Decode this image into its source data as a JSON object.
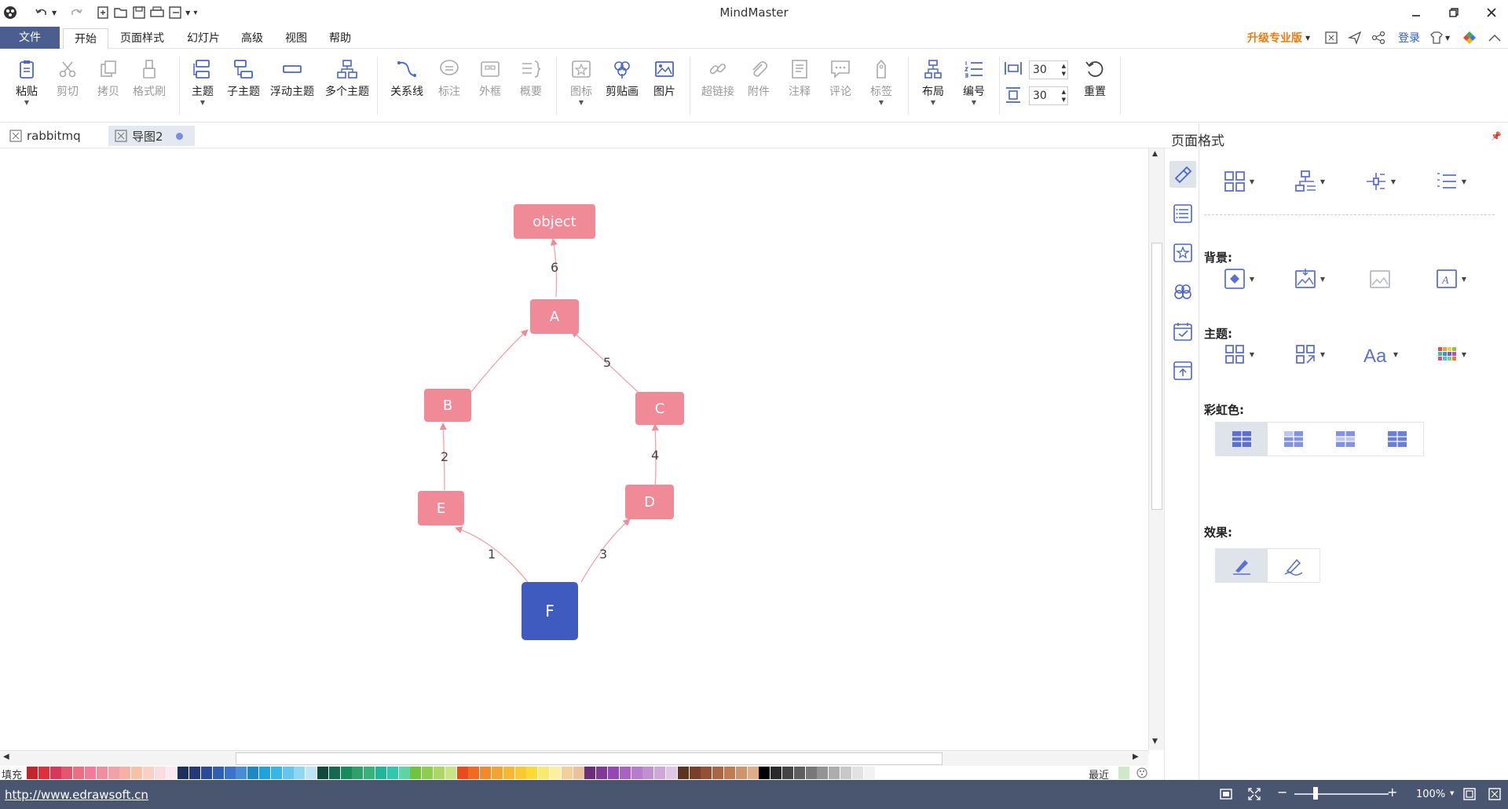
{
  "app": {
    "title": "MindMaster"
  },
  "menu": {
    "file": "文件",
    "items": [
      "开始",
      "页面样式",
      "幻灯片",
      "高级",
      "视图",
      "帮助"
    ],
    "upgrade": "升级专业版",
    "login": "登录"
  },
  "ribbon": {
    "paste": "粘贴",
    "cut": "剪切",
    "copy": "拷贝",
    "format_painter": "格式刷",
    "topic": "主题",
    "subtopic": "子主题",
    "floating_topic": "浮动主题",
    "multi_topic": "多个主题",
    "relationship": "关系线",
    "callout": "标注",
    "boundary": "外框",
    "summary": "概要",
    "icon": "图标",
    "clipart": "剪贴画",
    "picture": "图片",
    "hyperlink": "超链接",
    "attachment": "附件",
    "note": "注释",
    "comment": "评论",
    "tag": "标签",
    "layout": "布局",
    "numbering": "编号",
    "spacing_h": "30",
    "spacing_v": "30",
    "reset": "重置"
  },
  "tabs": [
    {
      "label": "rabbitmq",
      "active": false
    },
    {
      "label": "导图2",
      "active": true,
      "unsaved": true
    }
  ],
  "mindmap": {
    "nodes": {
      "object": "object",
      "A": "A",
      "B": "B",
      "C": "C",
      "D": "D",
      "E": "E",
      "F": "F"
    },
    "edges": {
      "FE": "1",
      "EB": "2",
      "FD": "3",
      "DC": "4",
      "CA": "5",
      "Aobject": "6"
    },
    "colors": {
      "topic": "#f08a96",
      "root": "#3f5bc0",
      "line": "#f08a96"
    }
  },
  "palette": {
    "fill_label": "填充",
    "recent_label": "最近"
  },
  "side_panel": {
    "title": "页面格式",
    "background_label": "背景:",
    "theme_label": "主题:",
    "rainbow_label": "彩虹色:",
    "effect_label": "效果:"
  },
  "status": {
    "url": "http://www.edrawsoft.cn",
    "zoom": "100%"
  }
}
